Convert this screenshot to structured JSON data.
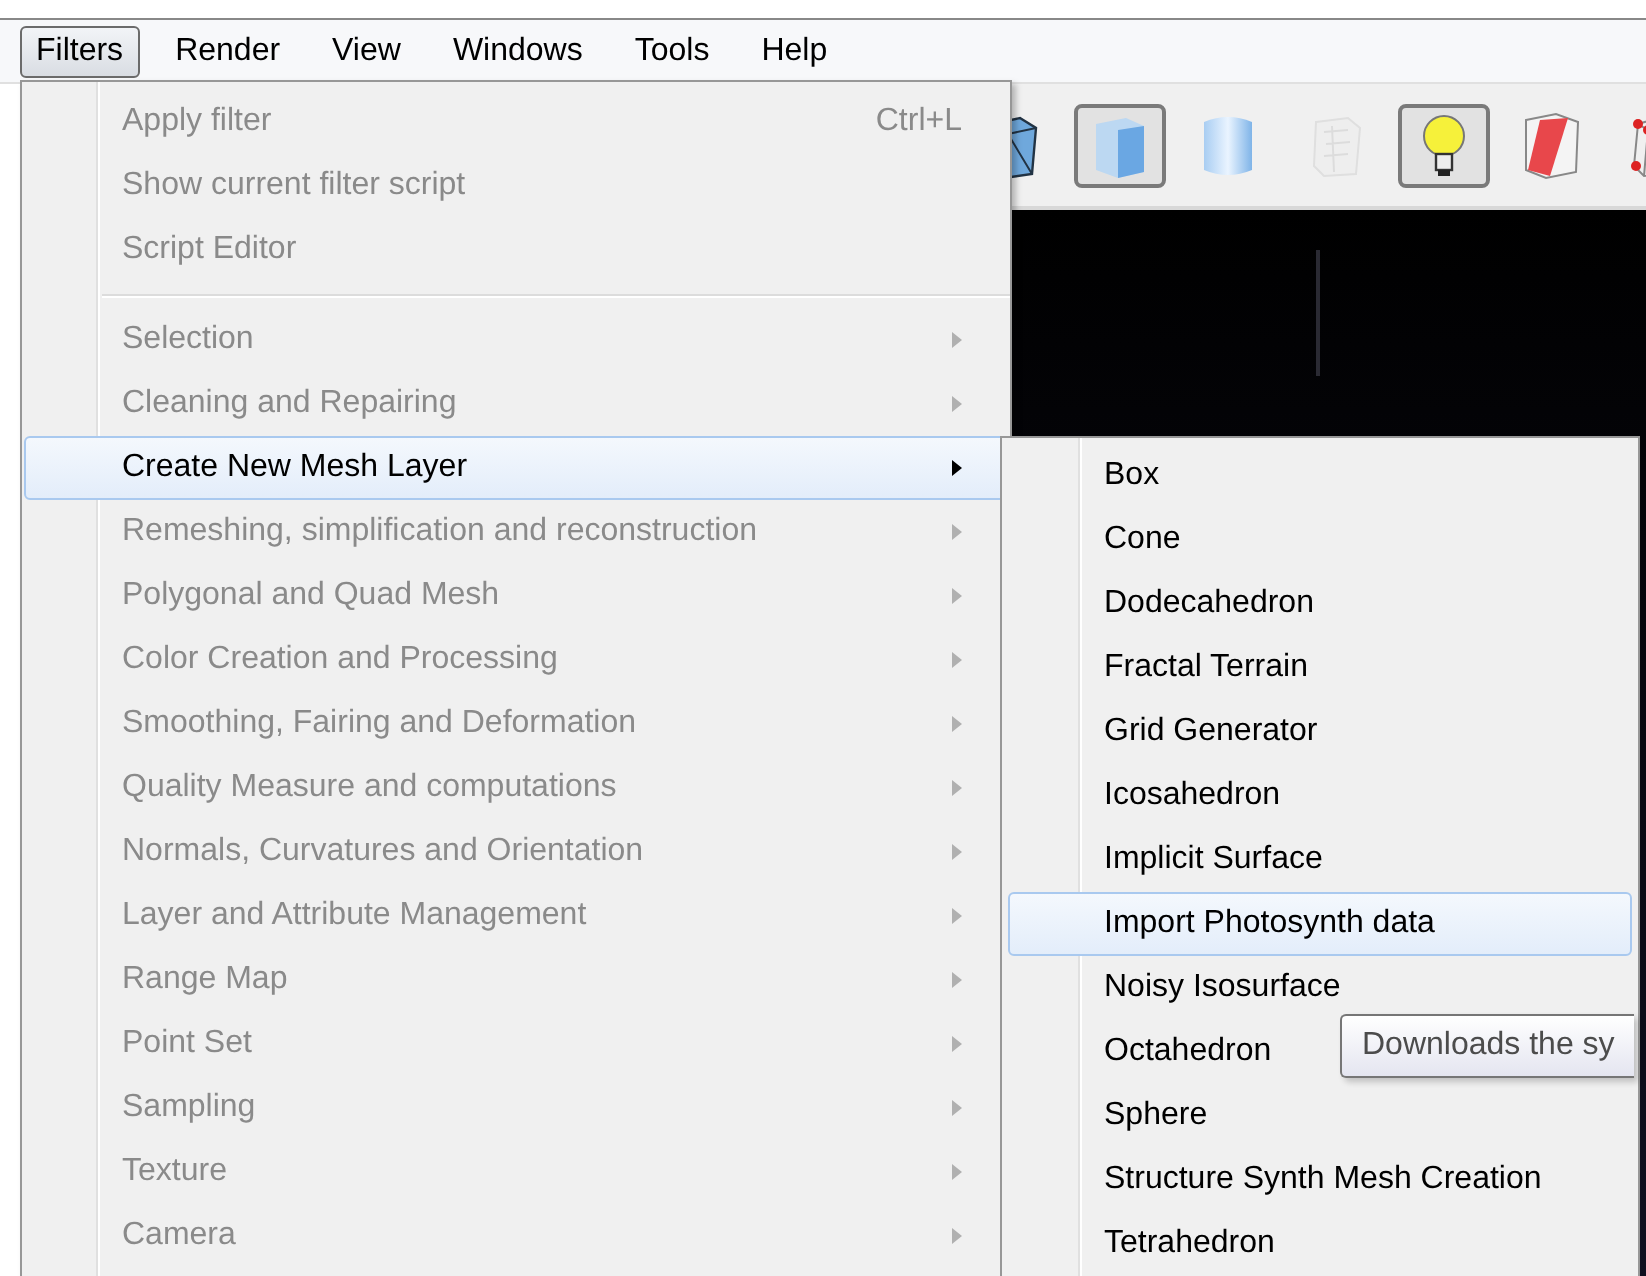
{
  "menubar": [
    {
      "label": "Filters",
      "selected": true
    },
    {
      "label": "Render",
      "selected": false
    },
    {
      "label": "View",
      "selected": false
    },
    {
      "label": "Windows",
      "selected": false
    },
    {
      "label": "Tools",
      "selected": false
    },
    {
      "label": "Help",
      "selected": false
    }
  ],
  "toolbar": [
    {
      "kind": "wireframe",
      "pressed": false,
      "disabled": false
    },
    {
      "kind": "flat",
      "pressed": true,
      "disabled": false
    },
    {
      "kind": "smooth",
      "pressed": false,
      "disabled": false
    },
    {
      "kind": "texture",
      "pressed": false,
      "disabled": true
    },
    {
      "kind": "light",
      "pressed": true,
      "disabled": false
    },
    {
      "kind": "faces",
      "pressed": false,
      "disabled": false
    },
    {
      "kind": "vertices",
      "pressed": false,
      "disabled": false
    }
  ],
  "menu": [
    {
      "kind": "item",
      "label": "Apply filter",
      "shortcut": "Ctrl+L",
      "submenu": false,
      "disabled": true,
      "selected": false
    },
    {
      "kind": "item",
      "label": "Show current filter script",
      "submenu": false,
      "disabled": true,
      "selected": false
    },
    {
      "kind": "item",
      "label": "Script Editor",
      "submenu": false,
      "disabled": true,
      "selected": false
    },
    {
      "kind": "separator"
    },
    {
      "kind": "item",
      "label": "Selection",
      "submenu": true,
      "disabled": true,
      "selected": false
    },
    {
      "kind": "item",
      "label": "Cleaning and Repairing",
      "submenu": true,
      "disabled": true,
      "selected": false
    },
    {
      "kind": "item",
      "label": "Create New Mesh Layer",
      "submenu": true,
      "disabled": false,
      "selected": true
    },
    {
      "kind": "item",
      "label": "Remeshing, simplification and reconstruction",
      "submenu": true,
      "disabled": true,
      "selected": false
    },
    {
      "kind": "item",
      "label": "Polygonal and Quad Mesh",
      "submenu": true,
      "disabled": true,
      "selected": false
    },
    {
      "kind": "item",
      "label": "Color Creation and Processing",
      "submenu": true,
      "disabled": true,
      "selected": false
    },
    {
      "kind": "item",
      "label": "Smoothing, Fairing and Deformation",
      "submenu": true,
      "disabled": true,
      "selected": false
    },
    {
      "kind": "item",
      "label": "Quality Measure and computations",
      "submenu": true,
      "disabled": true,
      "selected": false
    },
    {
      "kind": "item",
      "label": "Normals, Curvatures and Orientation",
      "submenu": true,
      "disabled": true,
      "selected": false
    },
    {
      "kind": "item",
      "label": "Layer and Attribute Management",
      "submenu": true,
      "disabled": true,
      "selected": false
    },
    {
      "kind": "item",
      "label": "Range Map",
      "submenu": true,
      "disabled": true,
      "selected": false
    },
    {
      "kind": "item",
      "label": "Point Set",
      "submenu": true,
      "disabled": true,
      "selected": false
    },
    {
      "kind": "item",
      "label": "Sampling",
      "submenu": true,
      "disabled": true,
      "selected": false
    },
    {
      "kind": "item",
      "label": "Texture",
      "submenu": true,
      "disabled": true,
      "selected": false
    },
    {
      "kind": "item",
      "label": "Camera",
      "submenu": true,
      "disabled": true,
      "selected": false
    }
  ],
  "submenu": [
    {
      "label": "Box",
      "selected": false
    },
    {
      "label": "Cone",
      "selected": false
    },
    {
      "label": "Dodecahedron",
      "selected": false
    },
    {
      "label": "Fractal Terrain",
      "selected": false
    },
    {
      "label": "Grid Generator",
      "selected": false
    },
    {
      "label": "Icosahedron",
      "selected": false
    },
    {
      "label": "Implicit Surface",
      "selected": false
    },
    {
      "label": "Import Photosynth data",
      "selected": true
    },
    {
      "label": "Noisy Isosurface",
      "selected": false
    },
    {
      "label": "Octahedron",
      "selected": false
    },
    {
      "label": "Sphere",
      "selected": false
    },
    {
      "label": "Structure Synth Mesh Creation",
      "selected": false
    },
    {
      "label": "Tetrahedron",
      "selected": false
    }
  ],
  "tooltip": {
    "text": "Downloads the sy"
  }
}
